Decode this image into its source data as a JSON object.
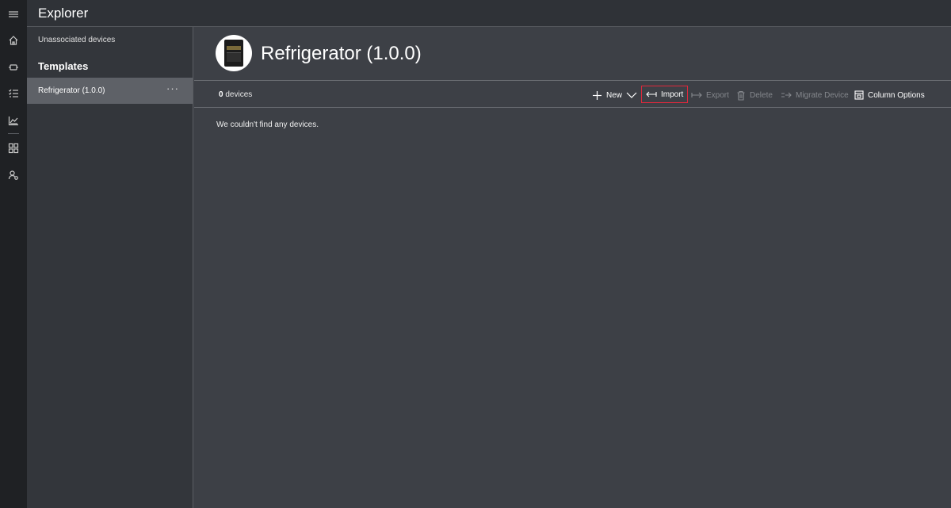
{
  "app": {
    "title": "Explorer"
  },
  "rail": {
    "icons": [
      "hamburger-menu-icon",
      "home-icon",
      "device-icon",
      "rules-list-icon",
      "analytics-icon",
      "dashboard-grid-icon",
      "admin-user-icon"
    ]
  },
  "left_panel": {
    "unassociated_label": "Unassociated devices",
    "templates_heading": "Templates",
    "templates": [
      {
        "label": "Refrigerator (1.0.0)",
        "more": "···",
        "selected": true
      }
    ]
  },
  "main": {
    "title": "Refrigerator (1.0.0)",
    "device_count": "0",
    "device_count_suffix": "devices",
    "empty_message": "We couldn't find any devices."
  },
  "toolbar": {
    "new_label": "New",
    "import_label": "Import",
    "export_label": "Export",
    "delete_label": "Delete",
    "migrate_label": "Migrate Device",
    "column_options_label": "Column Options"
  },
  "colors": {
    "rail_bg": "#1f2124",
    "topbar_bg": "#2f3237",
    "panel_bg": "#33363b",
    "main_bg": "#3d4046",
    "selected_item_bg": "#5e6167",
    "highlight_border": "#e0283c"
  }
}
